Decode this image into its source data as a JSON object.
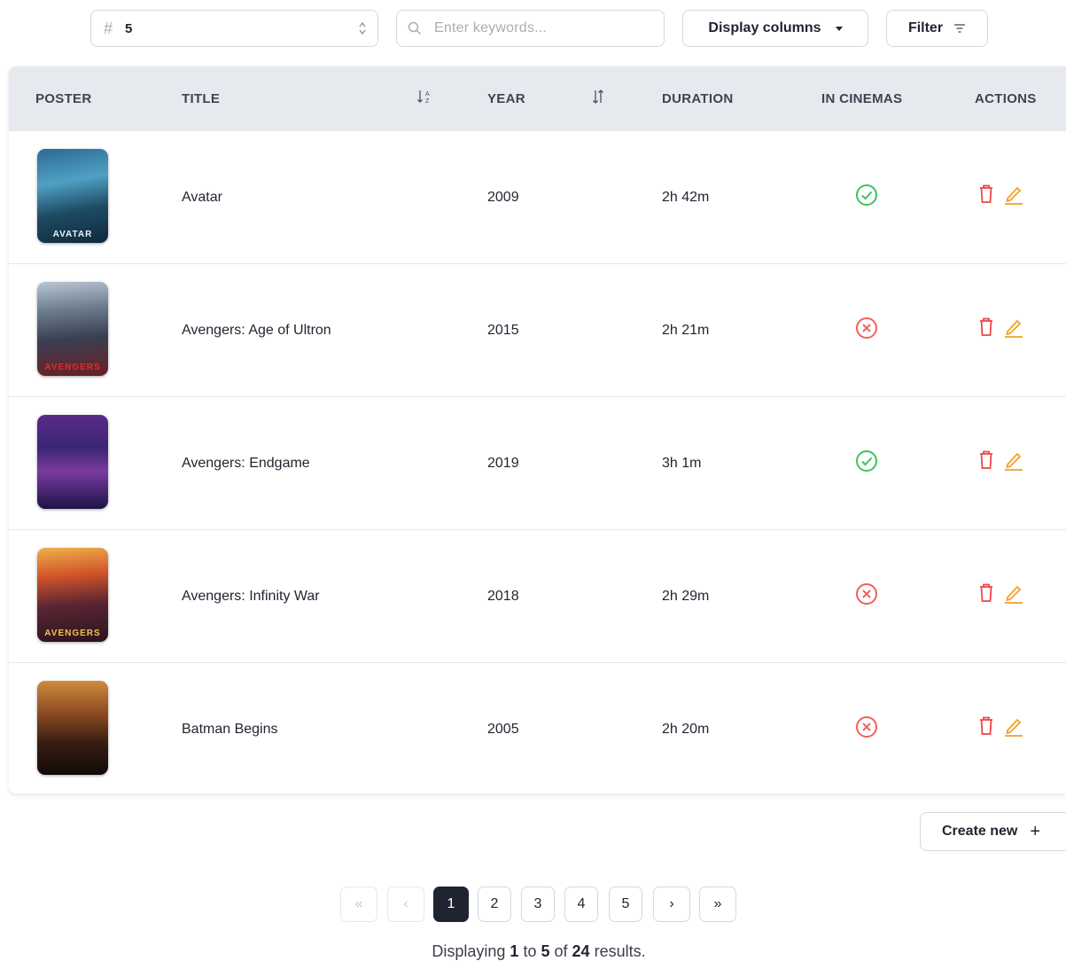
{
  "toolbar": {
    "per_page_value": "5",
    "search_placeholder": "Enter keywords...",
    "display_columns_label": "Display columns",
    "filter_label": "Filter"
  },
  "table": {
    "columns": [
      "POSTER",
      "TITLE",
      "YEAR",
      "DURATION",
      "IN CINEMAS",
      "ACTIONS"
    ],
    "rows": [
      {
        "title": "Avatar",
        "year": "2009",
        "duration": "2h 42m",
        "in_cinemas": true,
        "poster_caption": "AVATAR"
      },
      {
        "title": "Avengers: Age of Ultron",
        "year": "2015",
        "duration": "2h 21m",
        "in_cinemas": false,
        "poster_caption": "AVENGERS"
      },
      {
        "title": "Avengers: Endgame",
        "year": "2019",
        "duration": "3h 1m",
        "in_cinemas": true,
        "poster_caption": ""
      },
      {
        "title": "Avengers: Infinity War",
        "year": "2018",
        "duration": "2h 29m",
        "in_cinemas": false,
        "poster_caption": "AVENGERS"
      },
      {
        "title": "Batman Begins",
        "year": "2005",
        "duration": "2h 20m",
        "in_cinemas": false,
        "poster_caption": ""
      }
    ]
  },
  "create_label": "Create new",
  "pagination": {
    "pages": [
      "1",
      "2",
      "3",
      "4",
      "5"
    ],
    "first": "«",
    "prev": "‹",
    "next": "›",
    "last": "»",
    "current": 1
  },
  "summary": {
    "prefix": "Displaying",
    "from": "1",
    "to_word": "to",
    "to": "5",
    "of_word": "of",
    "total": "24",
    "suffix": "results."
  },
  "colors": {
    "check": "#3cc45a",
    "cross": "#f0605a",
    "delete": "#ef4444",
    "edit": "#f0a12a",
    "active_page": "#1f2430"
  },
  "icons": {
    "in_cinema_yes": "check-circle-icon",
    "in_cinema_no": "x-circle-icon",
    "delete": "trash-icon",
    "edit": "pencil-icon"
  }
}
